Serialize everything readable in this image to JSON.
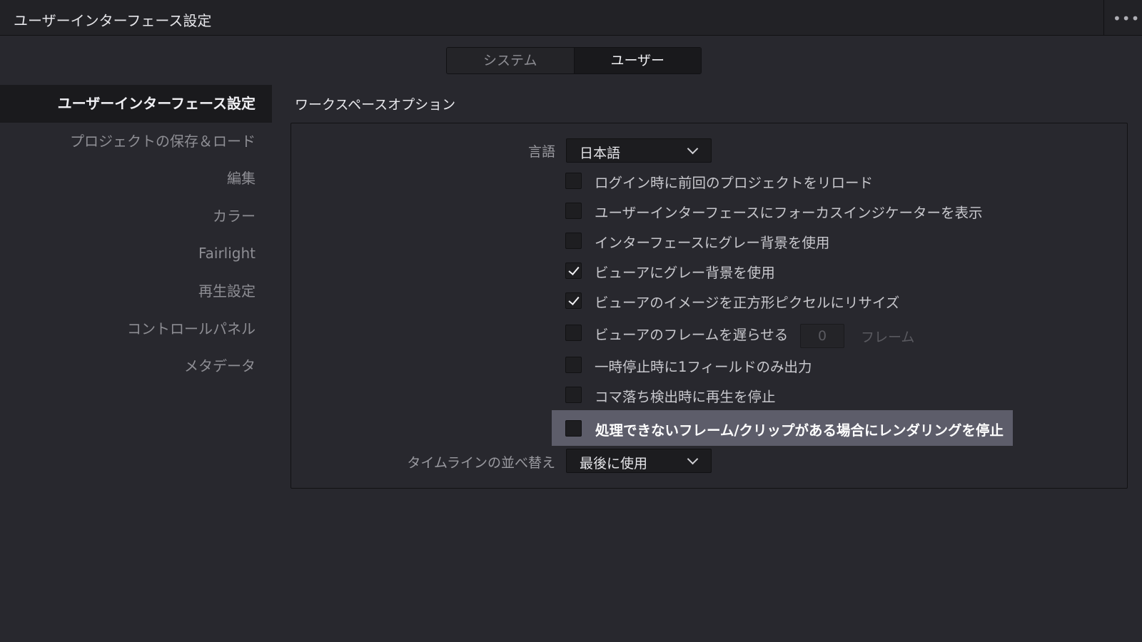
{
  "window": {
    "title": "ユーザーインターフェース設定",
    "menu_glyph": "•••"
  },
  "tabs": [
    {
      "label": "システム",
      "active": false
    },
    {
      "label": "ユーザー",
      "active": true
    }
  ],
  "sidebar": {
    "items": [
      {
        "label": "ユーザーインターフェース設定",
        "active": true
      },
      {
        "label": "プロジェクトの保存＆ロード"
      },
      {
        "label": "編集"
      },
      {
        "label": "カラー"
      },
      {
        "label": "Fairlight"
      },
      {
        "label": "再生設定"
      },
      {
        "label": "コントロールパネル"
      },
      {
        "label": "メタデータ"
      }
    ]
  },
  "workspace": {
    "title": "ワークスペースオプション",
    "language": {
      "label": "言語",
      "value": "日本語"
    },
    "options": [
      {
        "label": "ログイン時に前回のプロジェクトをリロード",
        "checked": false
      },
      {
        "label": "ユーザーインターフェースにフォーカスインジケーターを表示",
        "checked": false
      },
      {
        "label": "インターフェースにグレー背景を使用",
        "checked": false
      },
      {
        "label": "ビューアにグレー背景を使用",
        "checked": true
      },
      {
        "label": "ビューアのイメージを正方形ピクセルにリサイズ",
        "checked": true
      },
      {
        "label": "ビューアのフレームを遅らせる",
        "checked": false
      },
      {
        "label": "一時停止時に1フィールドのみ出力",
        "checked": false
      },
      {
        "label": "コマ落ち検出時に再生を停止",
        "checked": false
      },
      {
        "label": "処理できないフレーム/クリップがある場合にレンダリングを停止",
        "checked": false
      }
    ],
    "delay_frames": {
      "value": "0",
      "unit": "フレーム"
    },
    "timeline_sort": {
      "label": "タイムラインの並べ替え",
      "value": "最後に使用"
    }
  }
}
